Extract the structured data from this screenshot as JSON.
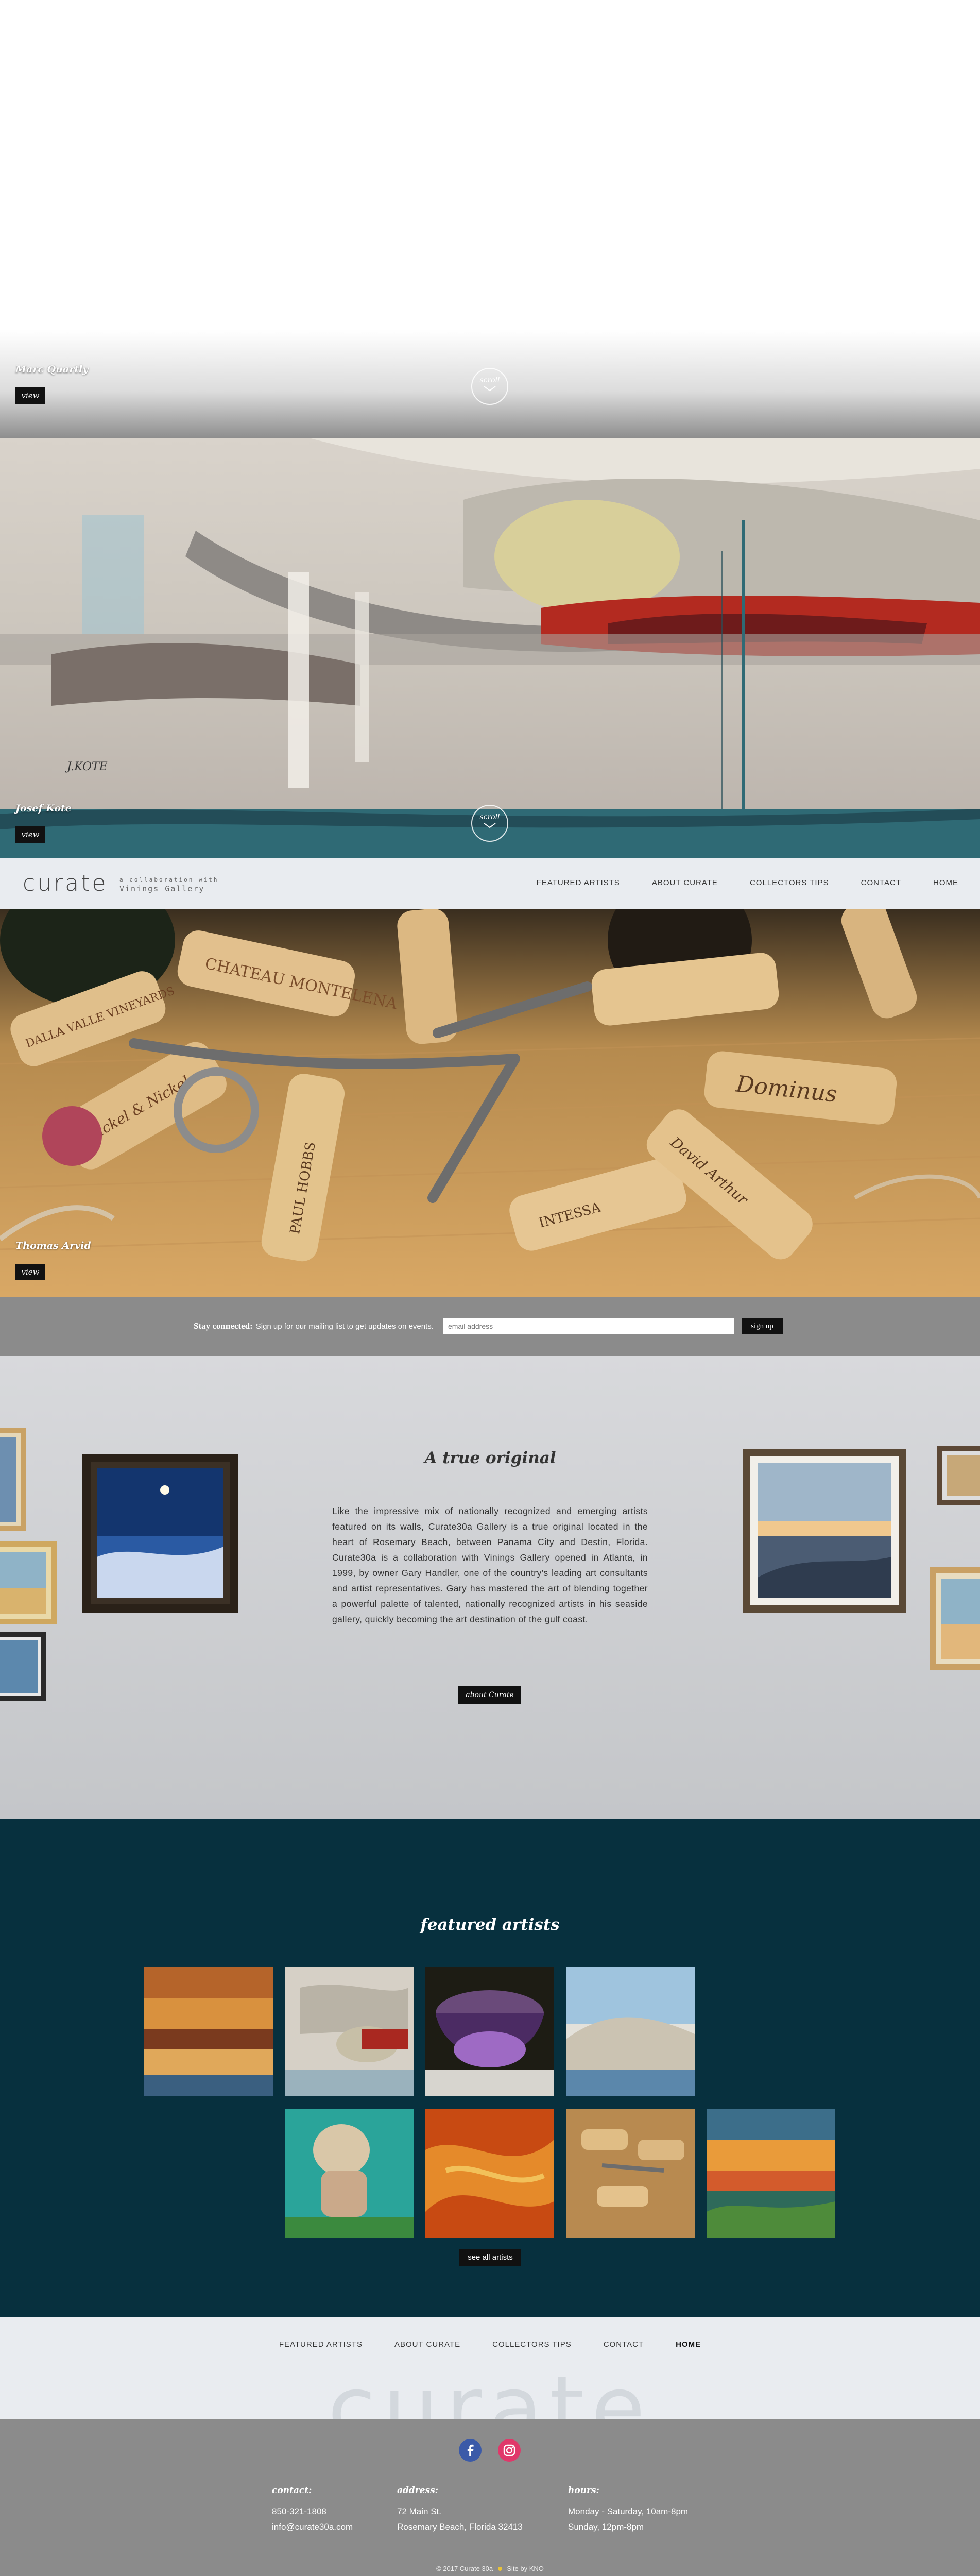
{
  "slides": [
    {
      "artist": "Marc Quartly",
      "view_label": "view",
      "scroll_label": "scroll"
    },
    {
      "artist": "Josef Kote",
      "view_label": "view",
      "scroll_label": "scroll",
      "signature": "J.KOTE"
    },
    {
      "artist": "Thomas Arvid",
      "view_label": "view"
    }
  ],
  "header": {
    "logo": "curate",
    "logo_sub_line1": "a collaboration with",
    "logo_sub_line2": "Vinings Gallery",
    "nav": [
      "FEATURED ARTISTS",
      "ABOUT CURATE",
      "COLLECTORS TIPS",
      "CONTACT",
      "HOME"
    ]
  },
  "cork_labels": {
    "c1": "CHATEAU MONTELENA",
    "c2": "Dominus",
    "c3": "PAUL HOBBS",
    "c4": "Nickel & Nickel",
    "c5": "DALLA VALLE VINEYARDS",
    "c6": "INTESSA",
    "c7": "David Arthur"
  },
  "newsletter": {
    "label": "Stay connected:",
    "text": "Sign up for our mailing list to get updates on events.",
    "placeholder": "email address",
    "button": "sign up"
  },
  "about": {
    "title": "A true original",
    "text": "Like the impressive mix of nationally recognized and emerging artists featured on its walls, Curate30a Gallery is a true original located in the heart of Rosemary Beach, between Panama City and Destin, Florida. Curate30a is a collaboration with Vinings Gallery opened in Atlanta, in 1999, by owner Gary Handler, one of the country's leading art consultants and artist representatives. Gary has mastered the art of blending together a powerful palette of talented, nationally recognized artists in his seaside gallery, quickly becoming the art destination of the gulf coast.",
    "button": "about Curate"
  },
  "featured": {
    "title": "featured artists",
    "see_all": "see all artists"
  },
  "footer_nav": {
    "items": [
      "FEATURED ARTISTS",
      "ABOUT CURATE",
      "COLLECTORS TIPS",
      "CONTACT",
      "HOME"
    ],
    "bg_logo": "curate"
  },
  "footer": {
    "contact_heading": "contact:",
    "phone": "850-321-1808",
    "email": "info@curate30a.com",
    "address_heading": "address:",
    "address_line1": "72 Main St.",
    "address_line2": "Rosemary Beach, Florida 32413",
    "hours_heading": "hours:",
    "hours_line1": "Monday - Saturday, 10am-8pm",
    "hours_line2": "Sunday, 12pm-8pm",
    "copyright": "© 2017 Curate 30a",
    "site_by": "Site by KNO"
  },
  "colors": {
    "header_bg": "#e9ecf0",
    "newsletter_bg": "#8b8b8b",
    "featured_bg": "#07303e",
    "button_bg": "#111111",
    "facebook": "#3b5aa8",
    "instagram": "#e0386a"
  },
  "icons": [
    "chevron-down-icon",
    "facebook-icon",
    "instagram-icon"
  ]
}
